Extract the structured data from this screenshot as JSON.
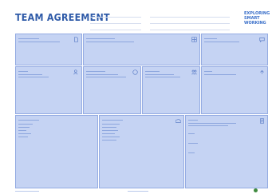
{
  "header": {
    "title": "TEAM AGREEMENT",
    "logo_lines": [
      "EXPLORING",
      "SMART",
      "WORKING"
    ]
  },
  "colors": {
    "accent": "#2e5aa8",
    "panel": "#c5d3f3",
    "panel_dark": "#a9bfed",
    "border": "#94abe2"
  },
  "panels": [
    {
      "key": "p1",
      "icon": "document-icon"
    },
    {
      "key": "p2",
      "icon": "grid-icon"
    },
    {
      "key": "p3",
      "icon": "chat-icon"
    },
    {
      "key": "p4",
      "icon": "people-icon"
    },
    {
      "key": "p5",
      "icon": "circle-icon"
    },
    {
      "key": "p6",
      "icon": "team-icon"
    },
    {
      "key": "p7",
      "icon": "upload-icon"
    },
    {
      "key": "p8",
      "icon": "list-icon"
    },
    {
      "key": "p9",
      "icon": "cloud-icon"
    },
    {
      "key": "p10",
      "icon": "note-icon"
    }
  ]
}
